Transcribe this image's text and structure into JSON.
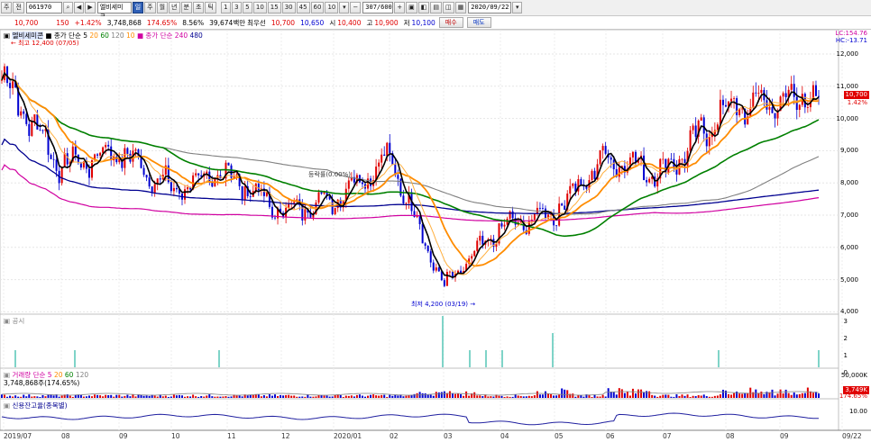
{
  "toolbar": {
    "btn1": "주",
    "btn2": "전",
    "code": "061970",
    "name": "엘비세미콘",
    "periods": [
      "일",
      "주",
      "월",
      "년",
      "분",
      "초",
      "틱"
    ],
    "intervals": [
      "1",
      "3",
      "5",
      "10",
      "15",
      "30",
      "45",
      "60",
      "10"
    ],
    "count": "307/600",
    "date": "2020/09/22"
  },
  "quote": {
    "price": "10,700",
    "change": "150",
    "change_pct": "+1.42%",
    "volume": "3,748,868",
    "vol_ratio": "174.65%",
    "turnover": "8.56%",
    "amount": "39,674백만",
    "pref_label": "최우선",
    "bid1": "10,700",
    "bid2": "10,650",
    "open_label": "시",
    "open": "10,400",
    "high_label": "고",
    "high": "10,900",
    "low_label": "저",
    "low": "10,100",
    "buy": "매수",
    "sell": "매도"
  },
  "price_panel": {
    "legend_name": "엘비세미콘",
    "legend_ma_label": "종가 단순",
    "ma_short": [
      "5",
      "20",
      "60",
      "120",
      "10"
    ],
    "legend_ma_long_label": "종가 단순",
    "ma_long": [
      "240",
      "480"
    ],
    "lc": "LC:154.76",
    "hc": "HC:-13.71",
    "y_ticks": [
      "12,000",
      "11,000",
      "10,000",
      "9,000",
      "8,000",
      "7,000",
      "6,000",
      "5,000",
      "4,000"
    ],
    "last_tag": "10,700",
    "last_pct": "1.42%",
    "high_note": "최고 12,400 (07/05)",
    "low_note": "최저 4,200 (03/19)",
    "mid_note": "등락률(0.00%)"
  },
  "notice_panel": {
    "legend": "공시",
    "y_ticks": [
      "3",
      "2",
      "1",
      "0"
    ]
  },
  "volume_panel": {
    "legend": "거래량",
    "legend_ma_label": "단순",
    "ma": [
      "5",
      "20",
      "60",
      "120"
    ],
    "value_note": "3,748,868주(174.65%)",
    "y_top": "50,000K",
    "tag": "3,749K",
    "pct": "174.65%"
  },
  "credit_panel": {
    "legend": "신용잔고율(종목별)",
    "y_top": "10.00"
  },
  "x_axis": [
    "2019/07",
    "08",
    "09",
    "10",
    "11",
    "12",
    "2020/01",
    "02",
    "03",
    "04",
    "05",
    "06",
    "07",
    "08",
    "09",
    "09/22"
  ],
  "colors": {
    "up": "#e00000",
    "down": "#0000d0",
    "ma5": "#000000",
    "ma20": "#ff8c00",
    "ma60": "#008000",
    "ma120": "#808080",
    "ma240": "#d000a0",
    "ma480": "#000090"
  },
  "chart_data": {
    "type": "candlestick",
    "x_range": [
      "2019/07",
      "2020/09/22"
    ],
    "ylim": [
      4000,
      12400
    ],
    "key_points": [
      {
        "date": "2019/07",
        "close": 11200
      },
      {
        "date": "2019/08",
        "close": 8500
      },
      {
        "date": "2019/09",
        "close": 9000
      },
      {
        "date": "2019/10",
        "close": 7800
      },
      {
        "date": "2019/11",
        "close": 8300
      },
      {
        "date": "2019/12",
        "close": 7100
      },
      {
        "date": "2020/01",
        "close": 7500
      },
      {
        "date": "2020/02",
        "close": 8800
      },
      {
        "date": "2020/03",
        "close": 4800
      },
      {
        "date": "2020/04",
        "close": 6600
      },
      {
        "date": "2020/05",
        "close": 7100
      },
      {
        "date": "2020/06",
        "close": 8800
      },
      {
        "date": "2020/07",
        "close": 8300
      },
      {
        "date": "2020/08",
        "close": 10300
      },
      {
        "date": "2020/09/22",
        "close": 10700
      }
    ]
  }
}
